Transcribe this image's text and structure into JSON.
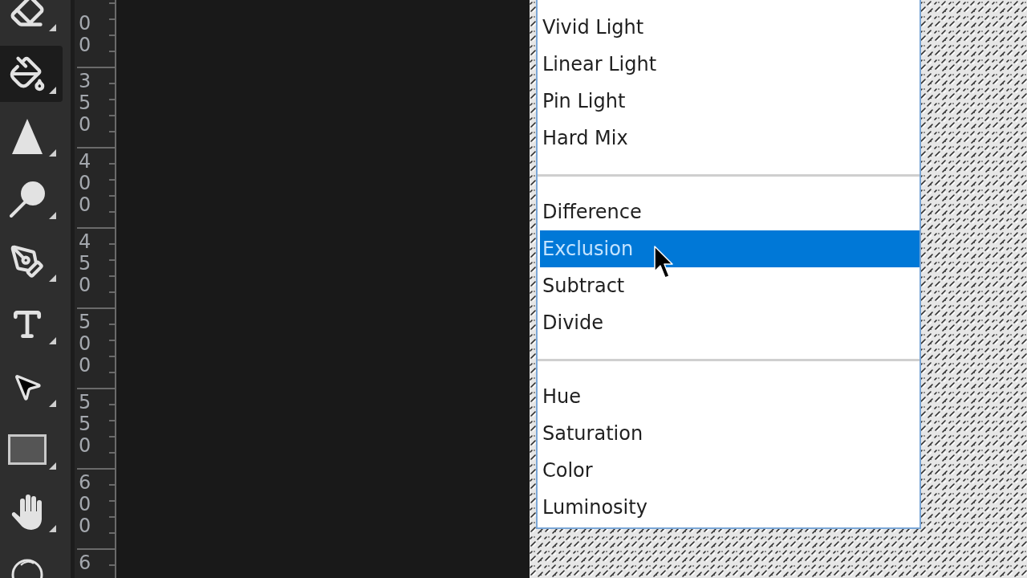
{
  "toolbar": {
    "tools": [
      {
        "kind": "eraser",
        "selected": false
      },
      {
        "kind": "paint-bucket",
        "selected": true
      },
      {
        "kind": "triangle",
        "selected": false
      },
      {
        "kind": "magnifier",
        "selected": false
      },
      {
        "kind": "pen",
        "selected": false
      },
      {
        "kind": "type",
        "selected": false
      },
      {
        "kind": "arrow",
        "selected": false
      },
      {
        "kind": "rectangle",
        "selected": false
      },
      {
        "kind": "hand",
        "selected": false
      },
      {
        "kind": "circle",
        "selected": false
      }
    ]
  },
  "ruler": {
    "labels": [
      "00",
      "350",
      "400",
      "450",
      "500",
      "550",
      "600",
      "6"
    ]
  },
  "blend_menu": {
    "items": [
      {
        "kind": "option",
        "label": "Vivid Light",
        "selected": false
      },
      {
        "kind": "option",
        "label": "Linear Light",
        "selected": false
      },
      {
        "kind": "option",
        "label": "Pin Light",
        "selected": false
      },
      {
        "kind": "option",
        "label": "Hard Mix",
        "selected": false
      },
      {
        "kind": "separator"
      },
      {
        "kind": "option",
        "label": "Difference",
        "selected": false
      },
      {
        "kind": "option",
        "label": "Exclusion",
        "selected": true
      },
      {
        "kind": "option",
        "label": "Subtract",
        "selected": false
      },
      {
        "kind": "option",
        "label": "Divide",
        "selected": false
      },
      {
        "kind": "separator"
      },
      {
        "kind": "option",
        "label": "Hue",
        "selected": false
      },
      {
        "kind": "option",
        "label": "Saturation",
        "selected": false
      },
      {
        "kind": "option",
        "label": "Color",
        "selected": false
      },
      {
        "kind": "option",
        "label": "Luminosity",
        "selected": false
      }
    ]
  }
}
